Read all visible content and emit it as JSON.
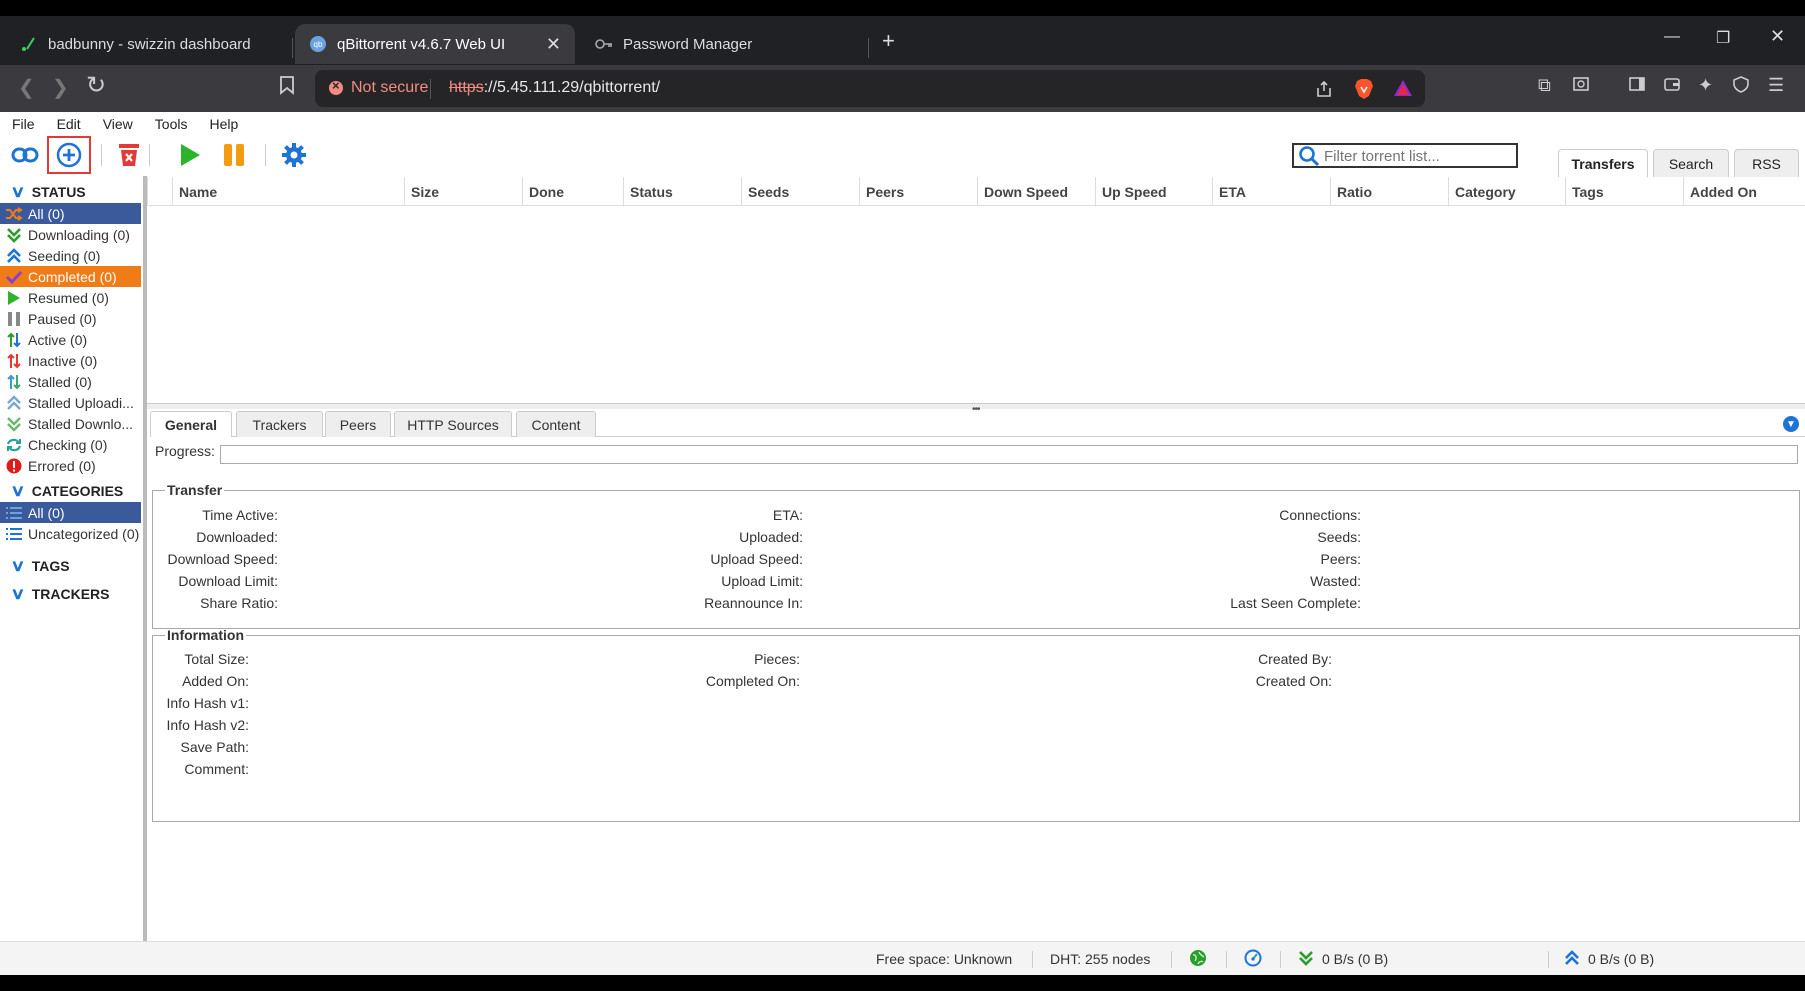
{
  "browser": {
    "tabs": [
      {
        "title": "badbunny - swizzin dashboard"
      },
      {
        "title": "qBittorrent v4.6.7 Web UI"
      },
      {
        "title": "Password Manager"
      }
    ],
    "security_label": "Not secure",
    "url_scheme": "https",
    "url_rest": "://5.45.111.29/qbittorrent/"
  },
  "menu": [
    "File",
    "Edit",
    "View",
    "Tools",
    "Help"
  ],
  "filter_placeholder": "Filter torrent list...",
  "right_tabs": [
    "Transfers",
    "Search",
    "RSS"
  ],
  "sidebar": {
    "status_title": "STATUS",
    "status_items": [
      {
        "label": "All (0)"
      },
      {
        "label": "Downloading (0)"
      },
      {
        "label": "Seeding (0)"
      },
      {
        "label": "Completed (0)"
      },
      {
        "label": "Resumed (0)"
      },
      {
        "label": "Paused (0)"
      },
      {
        "label": "Active (0)"
      },
      {
        "label": "Inactive (0)"
      },
      {
        "label": "Stalled (0)"
      },
      {
        "label": "Stalled Uploadi..."
      },
      {
        "label": "Stalled Downlo..."
      },
      {
        "label": "Checking (0)"
      },
      {
        "label": "Errored (0)"
      }
    ],
    "categories_title": "CATEGORIES",
    "category_items": [
      {
        "label": "All (0)"
      },
      {
        "label": "Uncategorized (0)"
      }
    ],
    "tags_title": "TAGS",
    "trackers_title": "TRACKERS"
  },
  "table_columns": [
    "Name",
    "Size",
    "Done",
    "Status",
    "Seeds",
    "Peers",
    "Down Speed",
    "Up Speed",
    "ETA",
    "Ratio",
    "Category",
    "Tags",
    "Added On"
  ],
  "prop_tabs": [
    "General",
    "Trackers",
    "Peers",
    "HTTP Sources",
    "Content"
  ],
  "general": {
    "progress_label": "Progress:",
    "progress_fraction": 0,
    "transfer_title": "Transfer",
    "transfer_col1": [
      "Time Active:",
      "Downloaded:",
      "Download Speed:",
      "Download Limit:",
      "Share Ratio:"
    ],
    "transfer_col2": [
      "ETA:",
      "Uploaded:",
      "Upload Speed:",
      "Upload Limit:",
      "Reannounce In:"
    ],
    "transfer_col3": [
      "Connections:",
      "Seeds:",
      "Peers:",
      "Wasted:",
      "Last Seen Complete:"
    ],
    "info_title": "Information",
    "info_col1": [
      "Total Size:",
      "Added On:",
      "Info Hash v1:",
      "Info Hash v2:",
      "Save Path:",
      "Comment:"
    ],
    "info_col2": [
      "Pieces:",
      "Completed On:"
    ],
    "info_col3": [
      "Created By:",
      "Created On:"
    ]
  },
  "statusbar": {
    "free_space": "Free space: Unknown",
    "dht": "DHT: 255 nodes",
    "download": "0 B/s (0 B)",
    "upload": "0 B/s (0 B)"
  },
  "colors": {
    "selected_blue": "#3a5a9c",
    "selected_orange": "#f07c17",
    "accent_blue": "#1e73d6",
    "delete_red": "#e53935",
    "resume_green": "#2bb52b",
    "pause_orange": "#f39c12"
  }
}
